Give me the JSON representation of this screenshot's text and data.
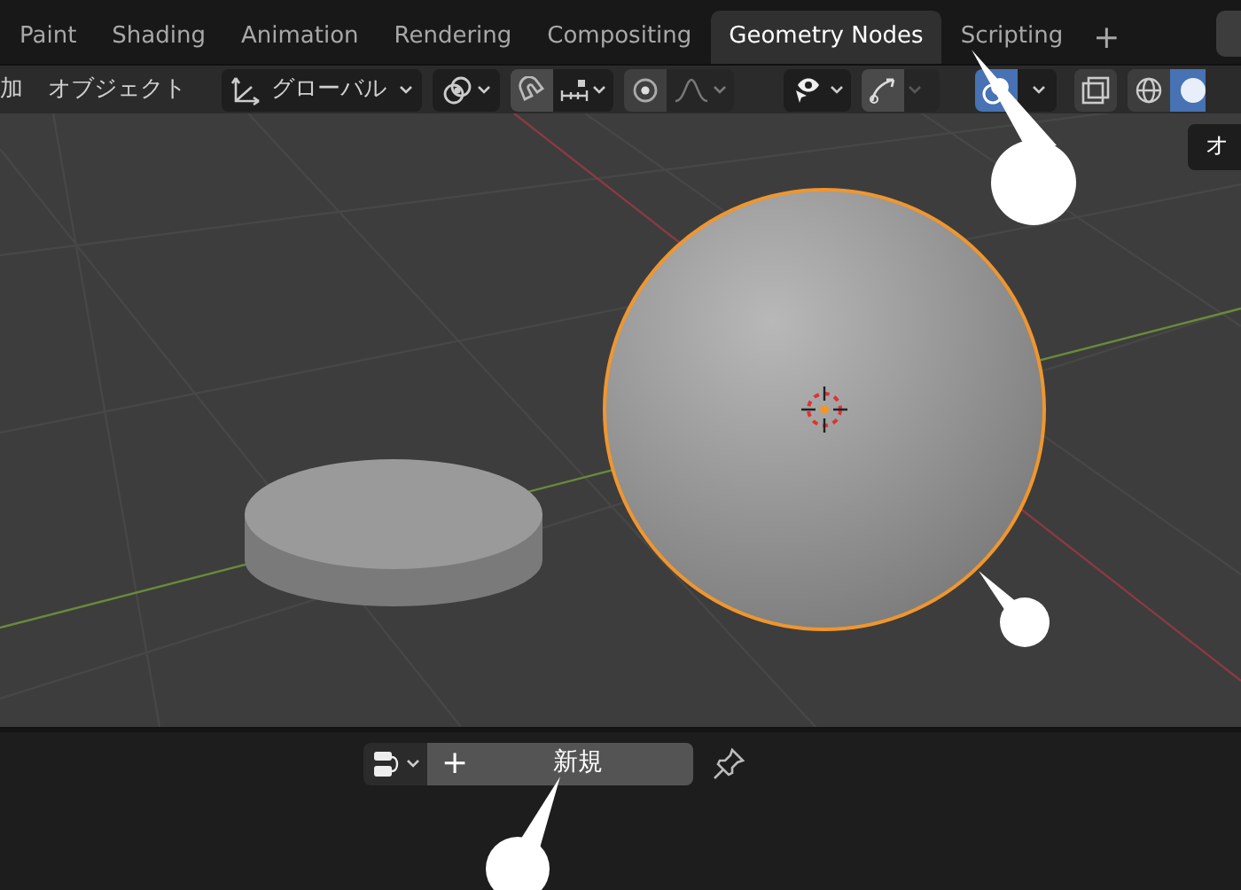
{
  "workspace_tabs": [
    {
      "label": "Paint",
      "selected": false
    },
    {
      "label": "Shading",
      "selected": false
    },
    {
      "label": "Animation",
      "selected": false
    },
    {
      "label": "Rendering",
      "selected": false
    },
    {
      "label": "Compositing",
      "selected": false
    },
    {
      "label": "Geometry Nodes",
      "selected": true
    },
    {
      "label": "Scripting",
      "selected": false
    }
  ],
  "add_tab": "+",
  "viewport_header": {
    "add_menu": "加",
    "object_menu": "オブジェクト",
    "orientation": "グローバル",
    "tooltip": "オ"
  },
  "node_editor_header": {
    "new_button_icon": "+",
    "new_button": "新規"
  }
}
